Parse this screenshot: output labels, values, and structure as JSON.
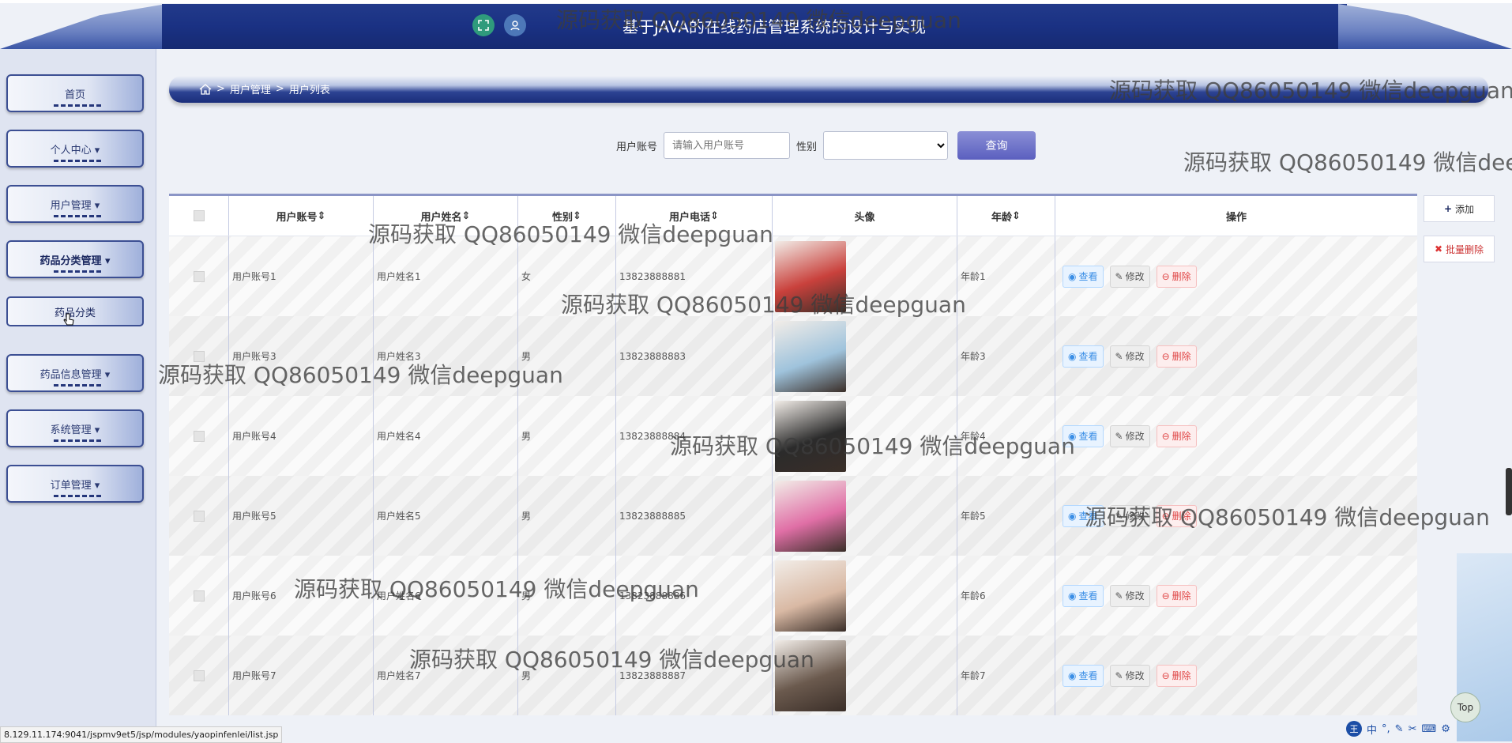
{
  "header": {
    "title": "基于JAVA的在线药店管理系统的设计与实现"
  },
  "sidebar": {
    "items": [
      {
        "label": "首页"
      },
      {
        "label": "个人中心 ▾"
      },
      {
        "label": "用户管理 ▾"
      },
      {
        "label": "药品分类管理 ▾"
      },
      {
        "label": "药品信息管理 ▾"
      },
      {
        "label": "系统管理 ▾"
      },
      {
        "label": "订单管理 ▾"
      }
    ],
    "sub_item": {
      "label": "药品分类"
    }
  },
  "breadcrumb": {
    "items": [
      "用户管理",
      "用户列表"
    ],
    "separator": ">"
  },
  "search": {
    "account_label": "用户账号",
    "account_placeholder": "请输入用户账号",
    "gender_label": "性别",
    "query_label": "查询"
  },
  "actions": {
    "add_label": "添加",
    "batch_delete_label": "批量删除"
  },
  "table": {
    "headers": [
      "用户账号",
      "用户姓名",
      "性别",
      "用户电话",
      "头像",
      "年龄",
      "操作"
    ],
    "rows": [
      {
        "account": "用户账号1",
        "name": "用户姓名1",
        "gender": "女",
        "phone": "13823888881",
        "age": "年龄1",
        "avatar_color": "#c9413c"
      },
      {
        "account": "用户账号3",
        "name": "用户姓名3",
        "gender": "男",
        "phone": "13823888883",
        "age": "年龄3",
        "avatar_color": "#9fc3dc"
      },
      {
        "account": "用户账号4",
        "name": "用户姓名4",
        "gender": "男",
        "phone": "13823888884",
        "age": "年龄4",
        "avatar_color": "#2b2b2b"
      },
      {
        "account": "用户账号5",
        "name": "用户姓名5",
        "gender": "男",
        "phone": "13823888885",
        "age": "年龄5",
        "avatar_color": "#e06fa6"
      },
      {
        "account": "用户账号6",
        "name": "用户姓名6",
        "gender": "男",
        "phone": "13823888886",
        "age": "年龄6",
        "avatar_color": "#d9b9a4"
      },
      {
        "account": "用户账号7",
        "name": "用户姓名7",
        "gender": "男",
        "phone": "13823888887",
        "age": "年龄7",
        "avatar_color": "#6b5a4e"
      }
    ],
    "op_view": "查看",
    "op_edit": "修改",
    "op_delete": "删除"
  },
  "watermark": "源码获取 QQ86050149 微信deepguan",
  "status_url": "8.129.11.174:9041/jspmv9et5/jsp/modules/yaopinfenlei/list.jsp",
  "top_button": "Top",
  "ime_label": "中"
}
